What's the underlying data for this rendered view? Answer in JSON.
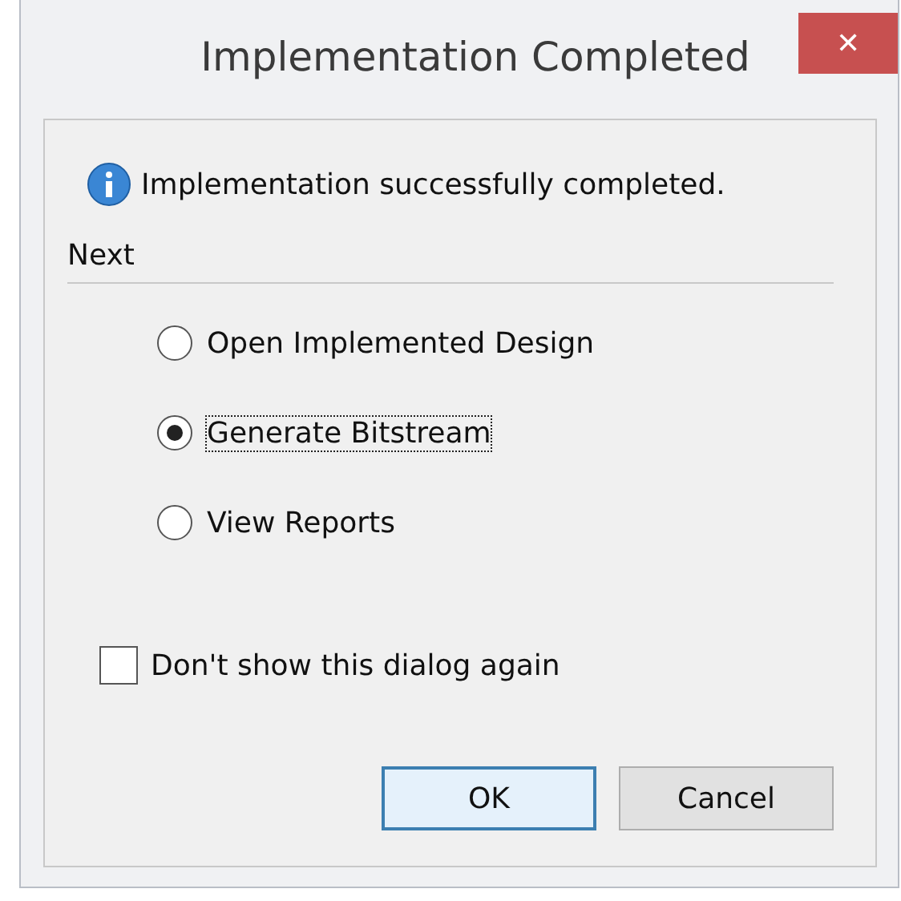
{
  "window": {
    "title": "Implementation Completed",
    "close": "✕"
  },
  "message": "Implementation successfully completed.",
  "section": "Next",
  "options": [
    {
      "label": "Open Implemented Design",
      "selected": false,
      "focused": false
    },
    {
      "label": "Generate Bitstream",
      "selected": true,
      "focused": true
    },
    {
      "label": "View Reports",
      "selected": false,
      "focused": false
    }
  ],
  "dont_show": {
    "label": "Don't show this dialog again",
    "checked": false
  },
  "buttons": [
    {
      "label": "OK",
      "default": true
    },
    {
      "label": "Cancel",
      "default": false
    }
  ]
}
